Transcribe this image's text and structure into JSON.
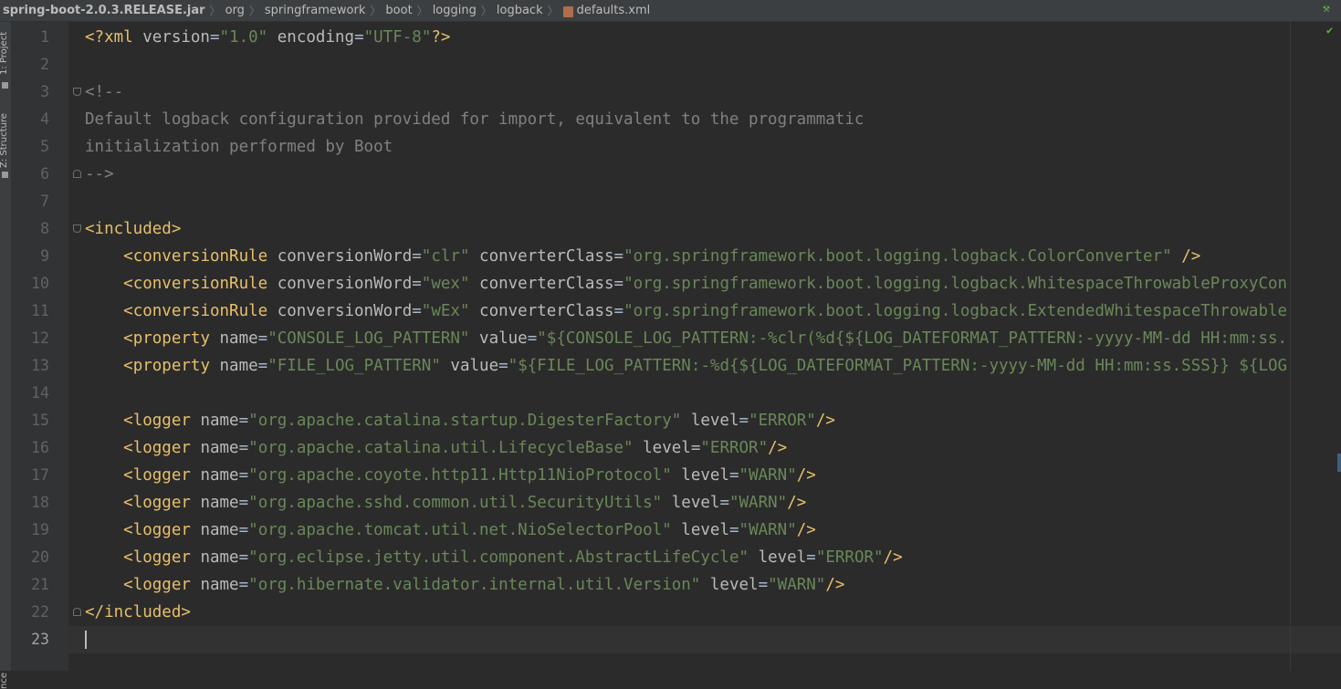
{
  "breadcrumb": {
    "items": [
      "spring-boot-2.0.3.RELEASE.jar",
      "org",
      "springframework",
      "boot",
      "logging",
      "logback",
      "defaults.xml"
    ],
    "separator": "〉"
  },
  "tool_windows": {
    "project": "1: Project",
    "structure": "Z: Structure",
    "favorites": "nce"
  },
  "colors": {
    "background": "#2b2b2b",
    "gutter": "#313335",
    "tag": "#e8bf6a",
    "attribute": "#bababa",
    "value": "#6a8759",
    "comment": "#808080",
    "current_line": "#323232"
  },
  "editor": {
    "current_line": 23,
    "line_numbers": [
      "1",
      "2",
      "3",
      "4",
      "5",
      "6",
      "7",
      "8",
      "9",
      "10",
      "11",
      "12",
      "13",
      "14",
      "15",
      "16",
      "17",
      "18",
      "19",
      "20",
      "21",
      "22",
      "23"
    ],
    "lines": [
      [
        [
          "t",
          "<?xml "
        ],
        [
          "a",
          "version"
        ],
        [
          "d",
          "="
        ],
        [
          "v",
          "\"1.0\""
        ],
        [
          "d",
          " "
        ],
        [
          "a",
          "encoding"
        ],
        [
          "d",
          "="
        ],
        [
          "v",
          "\"UTF-8\""
        ],
        [
          "t",
          "?>"
        ]
      ],
      [],
      [
        [
          "c",
          "<!--"
        ]
      ],
      [
        [
          "c",
          "Default logback configuration provided for import, equivalent to the programmatic"
        ]
      ],
      [
        [
          "c",
          "initialization performed by Boot"
        ]
      ],
      [
        [
          "c",
          "-->"
        ]
      ],
      [],
      [
        [
          "t",
          "<included>"
        ]
      ],
      [
        [
          "d",
          "    "
        ],
        [
          "t",
          "<conversionRule "
        ],
        [
          "a",
          "conversionWord"
        ],
        [
          "d",
          "="
        ],
        [
          "v",
          "\"clr\""
        ],
        [
          "d",
          " "
        ],
        [
          "a",
          "converterClass"
        ],
        [
          "d",
          "="
        ],
        [
          "v",
          "\"org.springframework.boot.logging.logback.ColorConverter\""
        ],
        [
          "d",
          " "
        ],
        [
          "t",
          "/>"
        ]
      ],
      [
        [
          "d",
          "    "
        ],
        [
          "t",
          "<conversionRule "
        ],
        [
          "a",
          "conversionWord"
        ],
        [
          "d",
          "="
        ],
        [
          "v",
          "\"wex\""
        ],
        [
          "d",
          " "
        ],
        [
          "a",
          "converterClass"
        ],
        [
          "d",
          "="
        ],
        [
          "v",
          "\"org.springframework.boot.logging.logback.WhitespaceThrowableProxyCon"
        ]
      ],
      [
        [
          "d",
          "    "
        ],
        [
          "t",
          "<conversionRule "
        ],
        [
          "a",
          "conversionWord"
        ],
        [
          "d",
          "="
        ],
        [
          "v",
          "\"wEx\""
        ],
        [
          "d",
          " "
        ],
        [
          "a",
          "converterClass"
        ],
        [
          "d",
          "="
        ],
        [
          "v",
          "\"org.springframework.boot.logging.logback.ExtendedWhitespaceThrowable"
        ]
      ],
      [
        [
          "d",
          "    "
        ],
        [
          "t",
          "<property "
        ],
        [
          "a",
          "name"
        ],
        [
          "d",
          "="
        ],
        [
          "v",
          "\"CONSOLE_LOG_PATTERN\""
        ],
        [
          "d",
          " "
        ],
        [
          "a",
          "value"
        ],
        [
          "d",
          "="
        ],
        [
          "v",
          "\"${CONSOLE_LOG_PATTERN:-%clr(%d{${LOG_DATEFORMAT_PATTERN:-yyyy-MM-dd HH:mm:ss."
        ]
      ],
      [
        [
          "d",
          "    "
        ],
        [
          "t",
          "<property "
        ],
        [
          "a",
          "name"
        ],
        [
          "d",
          "="
        ],
        [
          "v",
          "\"FILE_LOG_PATTERN\""
        ],
        [
          "d",
          " "
        ],
        [
          "a",
          "value"
        ],
        [
          "d",
          "="
        ],
        [
          "v",
          "\"${FILE_LOG_PATTERN:-%d{${LOG_DATEFORMAT_PATTERN:-yyyy-MM-dd HH:mm:ss.SSS}} ${LOG"
        ]
      ],
      [],
      [
        [
          "d",
          "    "
        ],
        [
          "t",
          "<logger "
        ],
        [
          "a",
          "name"
        ],
        [
          "d",
          "="
        ],
        [
          "v",
          "\"org.apache.catalina.startup.DigesterFactory\""
        ],
        [
          "d",
          " "
        ],
        [
          "a",
          "level"
        ],
        [
          "d",
          "="
        ],
        [
          "v",
          "\"ERROR\""
        ],
        [
          "t",
          "/>"
        ]
      ],
      [
        [
          "d",
          "    "
        ],
        [
          "t",
          "<logger "
        ],
        [
          "a",
          "name"
        ],
        [
          "d",
          "="
        ],
        [
          "v",
          "\"org.apache.catalina.util.LifecycleBase\""
        ],
        [
          "d",
          " "
        ],
        [
          "a",
          "level"
        ],
        [
          "d",
          "="
        ],
        [
          "v",
          "\"ERROR\""
        ],
        [
          "t",
          "/>"
        ]
      ],
      [
        [
          "d",
          "    "
        ],
        [
          "t",
          "<logger "
        ],
        [
          "a",
          "name"
        ],
        [
          "d",
          "="
        ],
        [
          "v",
          "\"org.apache.coyote.http11.Http11NioProtocol\""
        ],
        [
          "d",
          " "
        ],
        [
          "a",
          "level"
        ],
        [
          "d",
          "="
        ],
        [
          "v",
          "\"WARN\""
        ],
        [
          "t",
          "/>"
        ]
      ],
      [
        [
          "d",
          "    "
        ],
        [
          "t",
          "<logger "
        ],
        [
          "a",
          "name"
        ],
        [
          "d",
          "="
        ],
        [
          "v",
          "\"org.apache.sshd.common.util.SecurityUtils\""
        ],
        [
          "d",
          " "
        ],
        [
          "a",
          "level"
        ],
        [
          "d",
          "="
        ],
        [
          "v",
          "\"WARN\""
        ],
        [
          "t",
          "/>"
        ]
      ],
      [
        [
          "d",
          "    "
        ],
        [
          "t",
          "<logger "
        ],
        [
          "a",
          "name"
        ],
        [
          "d",
          "="
        ],
        [
          "v",
          "\"org.apache.tomcat.util.net.NioSelectorPool\""
        ],
        [
          "d",
          " "
        ],
        [
          "a",
          "level"
        ],
        [
          "d",
          "="
        ],
        [
          "v",
          "\"WARN\""
        ],
        [
          "t",
          "/>"
        ]
      ],
      [
        [
          "d",
          "    "
        ],
        [
          "t",
          "<logger "
        ],
        [
          "a",
          "name"
        ],
        [
          "d",
          "="
        ],
        [
          "v",
          "\"org.eclipse.jetty.util.component.AbstractLifeCycle\""
        ],
        [
          "d",
          " "
        ],
        [
          "a",
          "level"
        ],
        [
          "d",
          "="
        ],
        [
          "v",
          "\"ERROR\""
        ],
        [
          "t",
          "/>"
        ]
      ],
      [
        [
          "d",
          "    "
        ],
        [
          "t",
          "<logger "
        ],
        [
          "a",
          "name"
        ],
        [
          "d",
          "="
        ],
        [
          "v",
          "\"org.hibernate.validator.internal.util.Version\""
        ],
        [
          "d",
          " "
        ],
        [
          "a",
          "level"
        ],
        [
          "d",
          "="
        ],
        [
          "v",
          "\"WARN\""
        ],
        [
          "t",
          "/>"
        ]
      ],
      [
        [
          "t",
          "</included>"
        ]
      ],
      []
    ],
    "fold_markers": [
      {
        "line": 3,
        "kind": "start"
      },
      {
        "line": 6,
        "kind": "end"
      },
      {
        "line": 8,
        "kind": "start"
      },
      {
        "line": 22,
        "kind": "end"
      }
    ]
  }
}
